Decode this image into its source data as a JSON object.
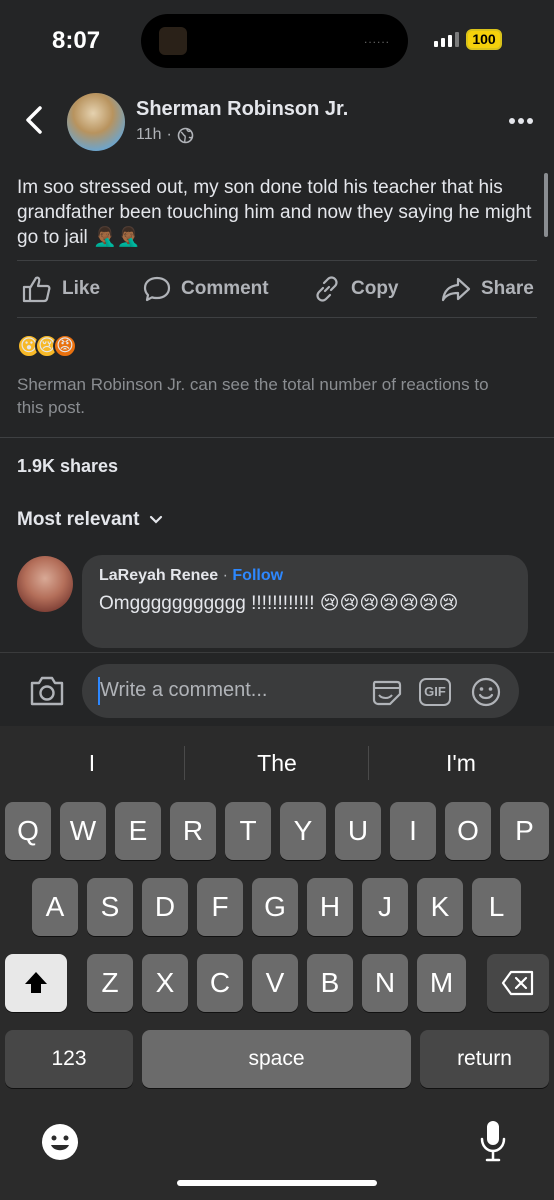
{
  "status_bar": {
    "time": "8:07",
    "battery": "100",
    "island_dots": "......"
  },
  "post": {
    "author": "Sherman Robinson Jr.",
    "age": "11h",
    "age_sep": "·",
    "text": "Im soo stressed out, my son done told his teacher that his grandfather been touching him  and now they saying he might go to jail 🤦🏾‍♂️🤦🏾‍♂️",
    "reactions": [
      "😮",
      "😢",
      "😡"
    ],
    "reach_note": "Sherman Robinson Jr. can see the total number of reactions to this post.",
    "shares": "1.9K shares"
  },
  "actions": {
    "like": "Like",
    "comment": "Comment",
    "copy": "Copy",
    "share": "Share"
  },
  "comments": {
    "sort_label": "Most relevant",
    "items": [
      {
        "author": "LaReyah Renee",
        "sep": "·",
        "follow": "Follow",
        "text": "Omggggggggggg !!!!!!!!!!!! 😢😢😢😢😢😢😢"
      }
    ]
  },
  "composer": {
    "placeholder": "Write a comment...",
    "gif_label": "GIF"
  },
  "keyboard": {
    "suggestions": [
      "I",
      "The",
      "I'm"
    ],
    "row1": [
      "Q",
      "W",
      "E",
      "R",
      "T",
      "Y",
      "U",
      "I",
      "O",
      "P"
    ],
    "row2": [
      "A",
      "S",
      "D",
      "F",
      "G",
      "H",
      "J",
      "K",
      "L"
    ],
    "row3": [
      "Z",
      "X",
      "C",
      "V",
      "B",
      "N",
      "M"
    ],
    "numbers_label": "123",
    "space_label": "space",
    "return_label": "return"
  },
  "colors": {
    "accent": "#2d88ff",
    "background": "#242526",
    "battery": "#f5d10b"
  },
  "icons": [
    "back-icon",
    "globe-icon",
    "more-icon",
    "like-icon",
    "comment-icon",
    "copy-icon",
    "share-icon",
    "chevron-down-icon",
    "camera-icon",
    "sticker-icon",
    "gif-icon",
    "emoji-icon",
    "shift-icon",
    "backspace-icon",
    "keyboard-emoji-icon",
    "microphone-icon"
  ]
}
